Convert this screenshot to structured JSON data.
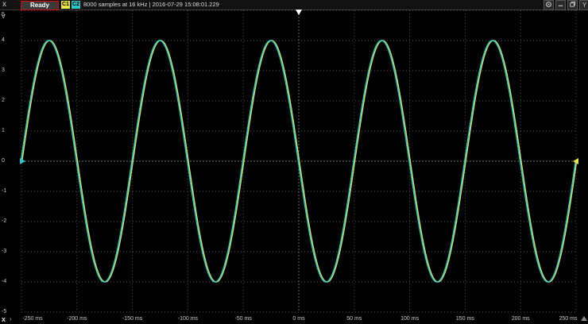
{
  "toolbar": {
    "close_label": "x",
    "status": "Ready",
    "channel1": "C1",
    "channel2": "C2",
    "info": "8000 samples at 16 kHz | 2016-07-29 15:08:01.229",
    "buttons": [
      "gear-icon",
      "minimize-icon",
      "restore-icon",
      "pin-icon",
      "y-button"
    ],
    "y_button_label": "Y"
  },
  "y_axis": {
    "unit": "V",
    "ticks": [
      "5",
      "4",
      "3",
      "2",
      "1",
      "0",
      "-1",
      "-2",
      "-3",
      "-4",
      "-5"
    ]
  },
  "x_axis": {
    "ticks": [
      "-250 ms",
      "-200 ms",
      "-150 ms",
      "-100 ms",
      "-50 ms",
      "0 ms",
      "50 ms",
      "100 ms",
      "150 ms",
      "200 ms",
      "250 ms"
    ]
  },
  "colors": {
    "channel1": "#e6e64a",
    "channel2": "#2bc6c6",
    "grid": "#6a6a6a",
    "background": "#000000"
  },
  "chart_data": {
    "type": "line",
    "x_unit": "ms",
    "y_unit": "V",
    "xlim": [
      -250,
      250
    ],
    "ylim": [
      -5,
      5
    ],
    "grid": true,
    "series": [
      {
        "name": "C1",
        "amplitude": 4,
        "frequency_hz": 10,
        "phase": "-sin"
      },
      {
        "name": "C2",
        "amplitude": 4,
        "frequency_hz": 10,
        "phase": "-sin"
      }
    ]
  }
}
